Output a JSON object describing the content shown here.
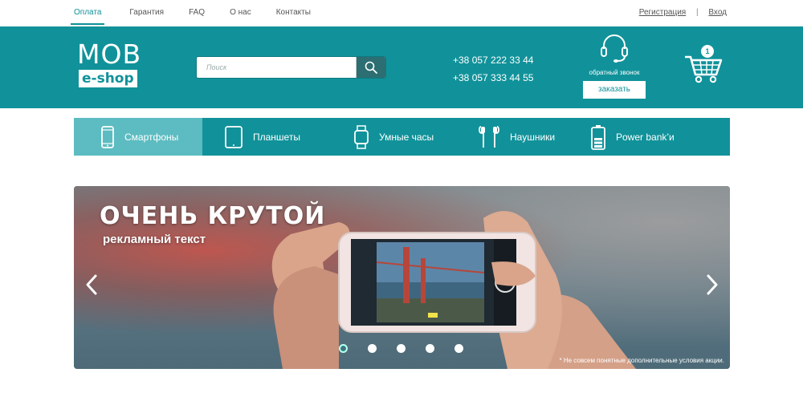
{
  "topnav": {
    "items": [
      {
        "label": "Оплата"
      },
      {
        "label": "Гарантия"
      },
      {
        "label": "FAQ"
      },
      {
        "label": "О нас"
      },
      {
        "label": "Контакты"
      }
    ],
    "active": "Оплата"
  },
  "auth": {
    "register": "Регистрация",
    "separator": "|",
    "login": "Вход"
  },
  "header": {
    "logo_top": "MOB",
    "logo_bottom": "e-shop",
    "search_placeholder": "Поиск",
    "phones": [
      "+38 057 222 33 44",
      "+38 057 333 44 55"
    ],
    "callback_label": "обратный звонок",
    "order_button": "заказать",
    "cart_count": "1"
  },
  "categories": [
    {
      "label": "Смартфоны",
      "icon": "smartphone-icon"
    },
    {
      "label": "Планшеты",
      "icon": "tablet-icon"
    },
    {
      "label": "Умные часы",
      "icon": "smartwatch-icon"
    },
    {
      "label": "Наушники",
      "icon": "earphones-icon"
    },
    {
      "label": "Power bank’и",
      "icon": "battery-icon"
    }
  ],
  "banner": {
    "title": "ОЧЕНЬ КРУТОЙ",
    "subtitle": "рекламный текст",
    "note": "* Не совсем понятные дополнительные условия акции.",
    "slides": 5,
    "active_slide": 1
  },
  "colors": {
    "primary": "#11929a",
    "active_category": "#5cbcc1",
    "search_button": "#2c6e72"
  }
}
